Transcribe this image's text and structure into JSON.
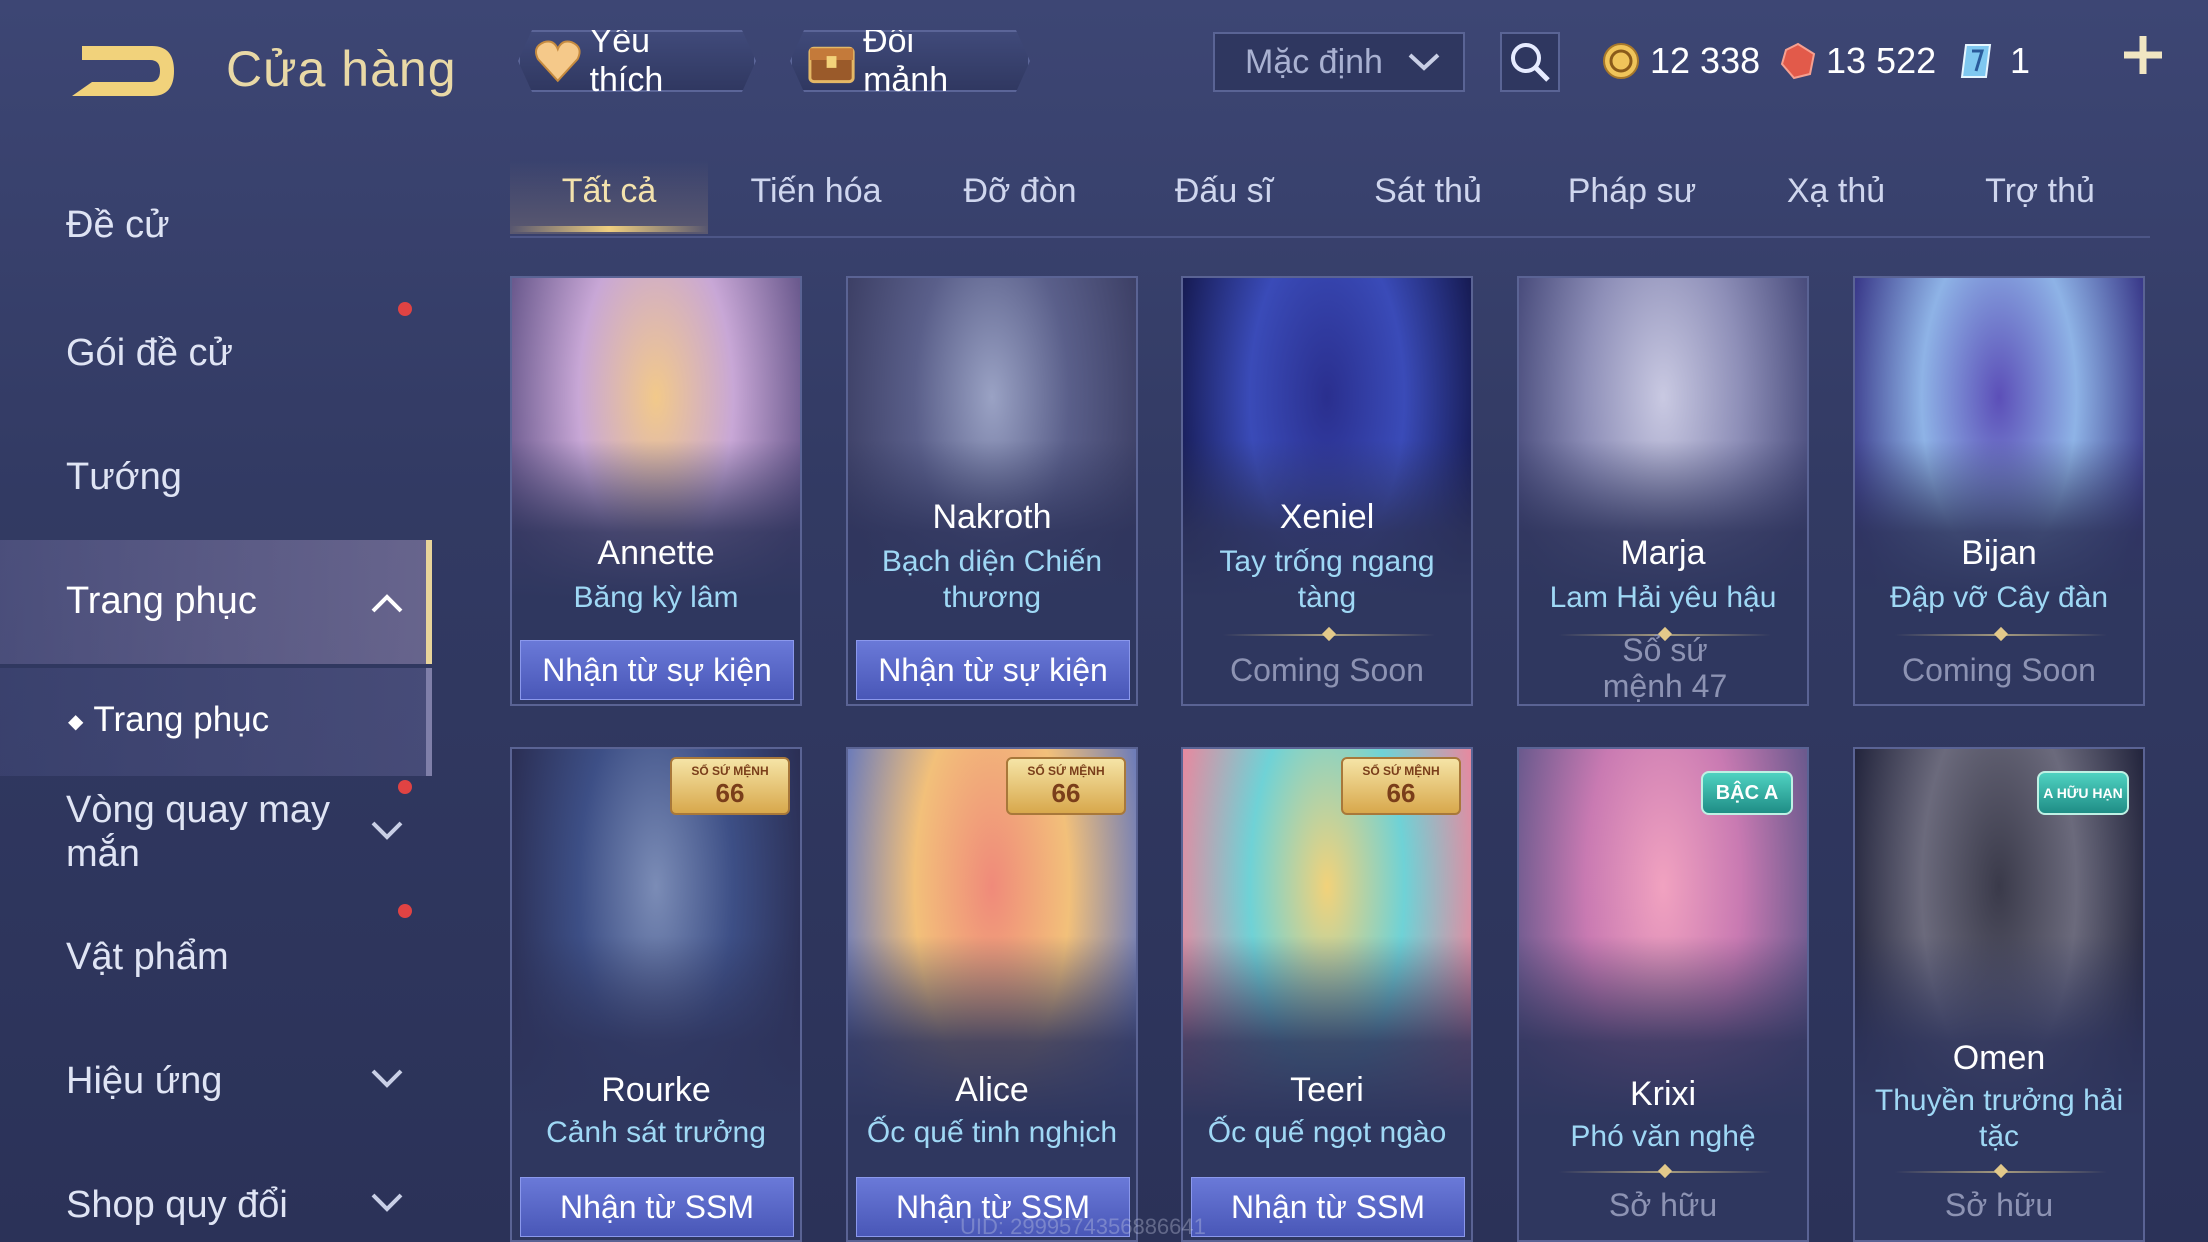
{
  "header": {
    "title": "Cửa hàng",
    "favorite_label": "Yêu thích",
    "exchange_label": "Đổi mảnh",
    "sort_value": "Mặc định",
    "currency": [
      {
        "icon": "gold-coin-icon",
        "value": "12 338"
      },
      {
        "icon": "red-gem-icon",
        "value": "13 522"
      },
      {
        "icon": "blue-crystal-icon",
        "value": "1"
      }
    ]
  },
  "sidebar": {
    "items": [
      {
        "label": "Đề cử"
      },
      {
        "label": "Gói đề cử"
      },
      {
        "label": "Tướng"
      },
      {
        "label": "Trang phục"
      },
      {
        "label": "Trang phục"
      },
      {
        "label": "Vòng quay may mắn"
      },
      {
        "label": "Vật phẩm"
      },
      {
        "label": "Hiệu ứng"
      },
      {
        "label": "Shop quy đổi"
      }
    ]
  },
  "tabs": [
    "Tất cả",
    "Tiến hóa",
    "Đỡ đòn",
    "Đấu sĩ",
    "Sát thủ",
    "Pháp sư",
    "Xạ thủ",
    "Trợ thủ"
  ],
  "cards": [
    {
      "hero": "Annette",
      "skin": "Băng kỳ lâm",
      "action": "Nhận từ sự kiện",
      "colors": [
        "#f2c98a",
        "#c8a7d6",
        "#6b5a8e"
      ]
    },
    {
      "hero": "Nakroth",
      "skin": "Bạch diện Chiến thương",
      "action": "Nhận từ sự kiện",
      "colors": [
        "#9aa2c4",
        "#5a5f8a",
        "#3d4066"
      ]
    },
    {
      "hero": "Xeniel",
      "skin": "Tay trống ngang tàng",
      "action": "Coming Soon",
      "colors": [
        "#2a2f8e",
        "#3a4bb8",
        "#171c55"
      ]
    },
    {
      "hero": "Marja",
      "skin": "Lam Hải yêu hậu",
      "action": "Sổ sứ mệnh 47",
      "colors": [
        "#c9c9e2",
        "#8e8fb8",
        "#4a4d7d"
      ]
    },
    {
      "hero": "Bijan",
      "skin": "Đập vỡ Cây đàn",
      "action": "Coming Soon",
      "colors": [
        "#5c4fb8",
        "#8eb3e6",
        "#3a3a8a"
      ]
    },
    {
      "hero": "Rourke",
      "skin": "Cảnh sát trưởng",
      "action": "Nhận từ SSM",
      "badge_title": "SỔ SỨ MỆNH",
      "badge_num": "66",
      "colors": [
        "#7b8cb6",
        "#3d4f86",
        "#2b2f55"
      ]
    },
    {
      "hero": "Alice",
      "skin": "Ốc quế tinh nghịch",
      "action": "Nhận từ SSM",
      "badge_title": "SỔ SỨ MỆNH",
      "badge_num": "66",
      "colors": [
        "#f08a7a",
        "#f2c07a",
        "#6f7db8"
      ]
    },
    {
      "hero": "Teeri",
      "skin": "Ốc quế ngọt ngào",
      "action": "Nhận từ SSM",
      "badge_title": "SỔ SỨ MỆNH",
      "badge_num": "66",
      "colors": [
        "#f2d27a",
        "#6fd2d6",
        "#e58aa0"
      ]
    },
    {
      "hero": "Krixi",
      "skin": "Phó văn nghệ",
      "action": "Sở hữu",
      "badge_label": "BẬC A",
      "colors": [
        "#f1a2c0",
        "#c97ab2",
        "#6c5a8e"
      ]
    },
    {
      "hero": "Omen",
      "skin": "Thuyền trưởng hải tặc",
      "action": "Sở hữu",
      "badge_label": "A HỮU HẠN",
      "colors": [
        "#3a3a4a",
        "#6b6a7c",
        "#24263e"
      ]
    }
  ],
  "footer": {
    "uid": "UID: 2999574356886641"
  }
}
